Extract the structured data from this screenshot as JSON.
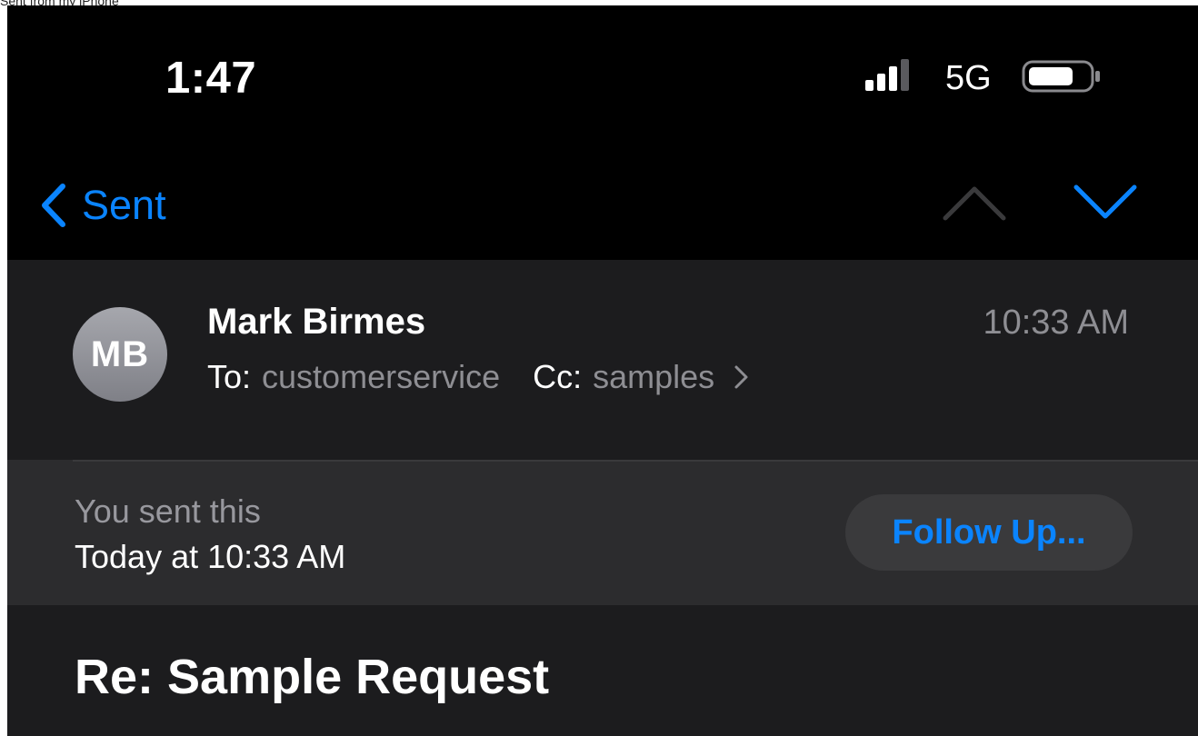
{
  "caption": "Sent from my iPhone",
  "status_bar": {
    "time": "1:47",
    "network": "5G"
  },
  "nav": {
    "back_label": "Sent",
    "up_icon": "chevron-up-icon",
    "down_icon": "chevron-down-icon"
  },
  "message": {
    "avatar_initials": "MB",
    "sender": "Mark Birmes",
    "time": "10:33 AM",
    "to_label": "To:",
    "to": "customerservice",
    "cc_label": "Cc:",
    "cc": "samples"
  },
  "banner": {
    "label": "You sent this",
    "date": "Today at 10:33 AM",
    "follow_up_label": "Follow Up..."
  },
  "subject": "Re: Sample Request",
  "colors": {
    "accent": "#0a84ff",
    "background": "#000000",
    "header_bg": "#1c1c1e",
    "banner_bg": "#2c2c2e",
    "secondary_text": "#8e8e93"
  }
}
